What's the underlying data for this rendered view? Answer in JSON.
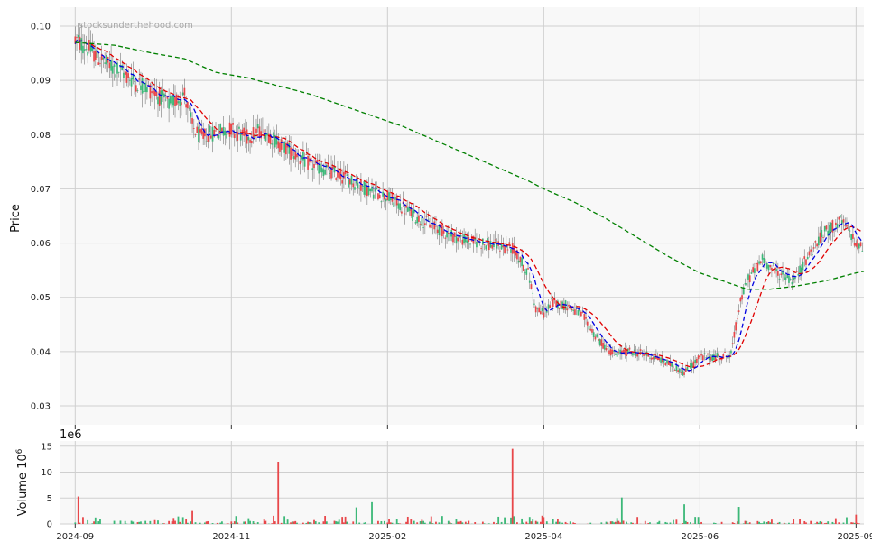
{
  "chart_data": {
    "type": "candlestick",
    "watermark": "stocksunderthehood.com",
    "colors": {
      "up": "#3cb878",
      "down": "#e8474a",
      "wick": "#777777",
      "ma_short": "#0000e0",
      "ma_mid": "#e00000",
      "ma_long": "#008000",
      "panel_bg": "#f8f8f8",
      "grid": "#cfcfcf"
    },
    "price_panel": {
      "ylabel": "Price",
      "ylim": [
        0.0265,
        0.1035
      ],
      "yticks": [
        "0.03",
        "0.04",
        "0.05",
        "0.06",
        "0.07",
        "0.08",
        "0.09",
        "0.10"
      ],
      "ytick_values": [
        0.03,
        0.04,
        0.05,
        0.06,
        0.07,
        0.08,
        0.09,
        0.1
      ]
    },
    "volume_panel": {
      "ylabel": "Volume  10",
      "ylabel_superscript": "6",
      "exponent_label": "1e6",
      "ylim": [
        0,
        16
      ],
      "yticks": [
        "0",
        "5",
        "10",
        "15"
      ],
      "ytick_values": [
        0,
        5,
        10,
        15
      ]
    },
    "x_axis": {
      "range_index": [
        -10,
        505
      ],
      "ticks": [
        "2024-09",
        "2024-11",
        "2025-02",
        "2025-04",
        "2025-06",
        "2025-09"
      ],
      "tick_index": [
        0,
        100,
        200,
        300,
        400,
        500
      ]
    },
    "trend_points": [
      [
        0,
        0.0975
      ],
      [
        10,
        0.0955
      ],
      [
        20,
        0.093
      ],
      [
        30,
        0.0915
      ],
      [
        40,
        0.0895
      ],
      [
        50,
        0.088
      ],
      [
        60,
        0.0855
      ],
      [
        70,
        0.0875
      ],
      [
        75,
        0.0815
      ],
      [
        80,
        0.0795
      ],
      [
        90,
        0.0805
      ],
      [
        100,
        0.081
      ],
      [
        110,
        0.0795
      ],
      [
        120,
        0.081
      ],
      [
        130,
        0.0785
      ],
      [
        140,
        0.0765
      ],
      [
        150,
        0.0745
      ],
      [
        160,
        0.0735
      ],
      [
        170,
        0.0725
      ],
      [
        180,
        0.071
      ],
      [
        190,
        0.0695
      ],
      [
        200,
        0.0685
      ],
      [
        210,
        0.0665
      ],
      [
        220,
        0.0645
      ],
      [
        230,
        0.063
      ],
      [
        240,
        0.0615
      ],
      [
        250,
        0.0605
      ],
      [
        260,
        0.06
      ],
      [
        270,
        0.0595
      ],
      [
        280,
        0.059
      ],
      [
        290,
        0.0545
      ],
      [
        295,
        0.048
      ],
      [
        300,
        0.047
      ],
      [
        305,
        0.049
      ],
      [
        315,
        0.0485
      ],
      [
        325,
        0.0465
      ],
      [
        335,
        0.042
      ],
      [
        345,
        0.0395
      ],
      [
        355,
        0.04
      ],
      [
        365,
        0.0395
      ],
      [
        375,
        0.0385
      ],
      [
        385,
        0.037
      ],
      [
        390,
        0.036
      ],
      [
        400,
        0.039
      ],
      [
        410,
        0.039
      ],
      [
        420,
        0.0395
      ],
      [
        425,
        0.048
      ],
      [
        430,
        0.053
      ],
      [
        440,
        0.057
      ],
      [
        450,
        0.0545
      ],
      [
        460,
        0.053
      ],
      [
        470,
        0.058
      ],
      [
        480,
        0.062
      ],
      [
        490,
        0.064
      ],
      [
        495,
        0.0625
      ],
      [
        500,
        0.06
      ],
      [
        505,
        0.059
      ]
    ],
    "volume_spikes": [
      {
        "index": 2,
        "value": 5.3,
        "dir": "down"
      },
      {
        "index": 75,
        "value": 2.5,
        "dir": "down"
      },
      {
        "index": 130,
        "value": 12.0,
        "dir": "down"
      },
      {
        "index": 180,
        "value": 3.2,
        "dir": "up"
      },
      {
        "index": 190,
        "value": 4.2,
        "dir": "up"
      },
      {
        "index": 280,
        "value": 14.5,
        "dir": "down"
      },
      {
        "index": 350,
        "value": 5.1,
        "dir": "up"
      },
      {
        "index": 390,
        "value": 3.8,
        "dir": "up"
      },
      {
        "index": 425,
        "value": 3.3,
        "dir": "up"
      },
      {
        "index": 500,
        "value": 1.8,
        "dir": "down"
      }
    ],
    "series": [
      {
        "name": "ma_long",
        "style": "dashed",
        "points": [
          [
            0,
            0.097
          ],
          [
            25,
            0.0965
          ],
          [
            50,
            0.095
          ],
          [
            70,
            0.094
          ],
          [
            90,
            0.0915
          ],
          [
            110,
            0.0905
          ],
          [
            130,
            0.089
          ],
          [
            150,
            0.0875
          ],
          [
            170,
            0.0855
          ],
          [
            190,
            0.0835
          ],
          [
            210,
            0.0815
          ],
          [
            230,
            0.079
          ],
          [
            250,
            0.0765
          ],
          [
            270,
            0.074
          ],
          [
            290,
            0.0715
          ],
          [
            300,
            0.07
          ],
          [
            320,
            0.0675
          ],
          [
            340,
            0.0645
          ],
          [
            360,
            0.061
          ],
          [
            380,
            0.0575
          ],
          [
            400,
            0.0545
          ],
          [
            420,
            0.0525
          ],
          [
            430,
            0.0515
          ],
          [
            445,
            0.0515
          ],
          [
            460,
            0.052
          ],
          [
            480,
            0.053
          ],
          [
            500,
            0.0545
          ],
          [
            505,
            0.0548
          ]
        ]
      }
    ]
  }
}
